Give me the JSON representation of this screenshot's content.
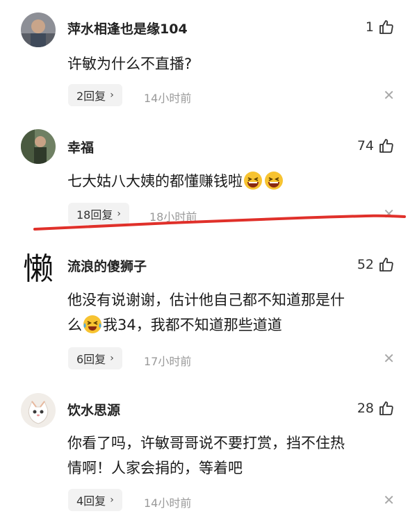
{
  "comments": [
    {
      "username": "萍水相逢也是缘104",
      "likes": "1",
      "text": "许敏为什么不直播?",
      "replies": "2回复",
      "time": "14小时前",
      "avatar": "photo-avatar"
    },
    {
      "username": "幸福",
      "likes": "74",
      "text": "七大姑八大姨的都懂赚钱啦",
      "replies": "18回复",
      "time": "18小时前",
      "avatar": "photo-avatar",
      "emojis": [
        "laughing-emoji",
        "laughing-emoji"
      ]
    },
    {
      "username": "流浪的傻狮子",
      "likes": "52",
      "text_line1": "他没有说谢谢，估计他自己都不知道那是什",
      "text_line2_a": "么",
      "text_line2_b": "我34，我都不知道那些道道",
      "replies": "6回复",
      "time": "17小时前",
      "avatar_char": "懒",
      "emojis": [
        "crying-laughing-emoji"
      ]
    },
    {
      "username": "饮水思源",
      "likes": "28",
      "text_line1": "你看了吗，许敏哥哥说不要打赏，挡不住热",
      "text_line2": "情啊！人家会捐的，等着吧",
      "replies": "4回复",
      "time": "14小时前",
      "avatar": "cat-avatar"
    }
  ],
  "icons": {
    "like": "thumbs-up-icon",
    "close": "close-icon",
    "chevron": "chevron-right-icon"
  },
  "glyphs": {
    "close": "✕",
    "chevron": "›"
  },
  "colors": {
    "annotation_line": "#e0302a",
    "reply_bg": "#f2f2f2",
    "time_text": "#9a9a9a"
  }
}
